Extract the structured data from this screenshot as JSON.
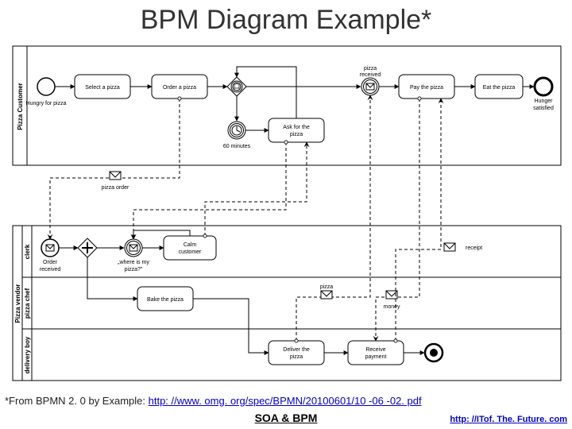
{
  "title": "BPM Diagram Example*",
  "pools": {
    "customer": {
      "name": "Pizza Customer"
    },
    "vendor": {
      "name": "Pizza vendor",
      "lanes": {
        "clerk": "clerk",
        "chef": "pizza chef",
        "delivery": "delivery boy"
      }
    }
  },
  "customer": {
    "start": "Hungry for pizza",
    "select": "Select a pizza",
    "order": "Order a pizza",
    "gateway_timer": "60 minutes",
    "ask": "Ask for the pizza",
    "received_evt": "pizza received",
    "pay": "Pay the pizza",
    "eat": "Eat the pizza",
    "end": "Hunger satisfied"
  },
  "vendor": {
    "order_received": "Order received",
    "where": "\"where is my pizza?\"",
    "calm": "Calm customer",
    "bake": "Bake the pizza",
    "deliver": "Deliver the pizza",
    "receive_payment": "Receive payment"
  },
  "messages": {
    "order": "pizza order",
    "pizza": "pizza",
    "money": "money",
    "receipt": "receipt"
  },
  "footer": {
    "prefix": "*From BPMN 2. 0 by Example: ",
    "spec_link": "http: //www. omg. org/spec/BPMN/20100601/10 -06 -02. pdf",
    "center": "SOA & BPM",
    "corner": "http: //ITof. The. Future. com"
  }
}
